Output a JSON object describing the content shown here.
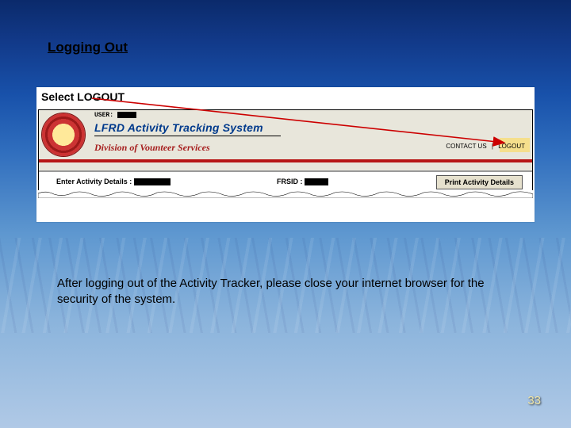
{
  "title": "Logging Out",
  "select_label": "Select LOGOUT",
  "screenshot": {
    "user_label": "USER:",
    "system_title": "LFRD Activity Tracking System",
    "division": "Division of Vounteer Services",
    "links": {
      "contact": "CONTACT US",
      "logout": "LOGOUT"
    },
    "bar": {
      "enter_label": "Enter Activity Details :",
      "frsid_label": "FRSID :",
      "print_button": "Print Activity Details"
    }
  },
  "note": "After logging out of the Activity Tracker, please close your internet browser for the security of the system.",
  "page_number": "33"
}
